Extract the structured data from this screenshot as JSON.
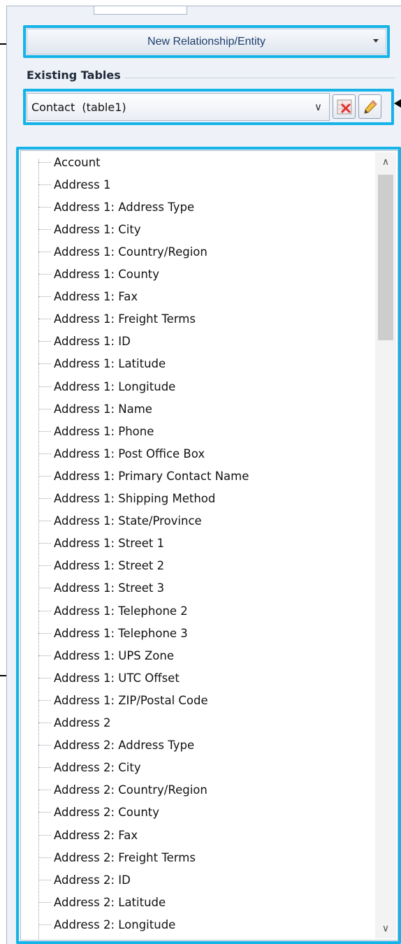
{
  "header": {
    "new_relationship_label": "New Relationship/Entity"
  },
  "existing_tables": {
    "label": "Existing Tables",
    "selected": "Contact  (table1)"
  },
  "fields": [
    "Account",
    "Address 1",
    "Address 1: Address Type",
    "Address 1: City",
    "Address 1: Country/Region",
    "Address 1: County",
    "Address 1: Fax",
    "Address 1: Freight Terms",
    "Address 1: ID",
    "Address 1: Latitude",
    "Address 1: Longitude",
    "Address 1: Name",
    "Address 1: Phone",
    "Address 1: Post Office Box",
    "Address 1: Primary Contact Name",
    "Address 1: Shipping Method",
    "Address 1: State/Province",
    "Address 1: Street 1",
    "Address 1: Street 2",
    "Address 1: Street 3",
    "Address 1: Telephone 2",
    "Address 1: Telephone 3",
    "Address 1: UPS Zone",
    "Address 1: UTC Offset",
    "Address 1: ZIP/Postal Code",
    "Address 2",
    "Address 2: Address Type",
    "Address 2: City",
    "Address 2: Country/Region",
    "Address 2: County",
    "Address 2: Fax",
    "Address 2: Freight Terms",
    "Address 2: ID",
    "Address 2: Latitude",
    "Address 2: Longitude"
  ],
  "icons": {
    "delete": "delete-table-icon",
    "edit": "edit-pencil-icon",
    "dropdown": "chevron-down-icon",
    "scroll_up": "chevron-up-icon",
    "scroll_down": "chevron-down-icon"
  },
  "colors": {
    "highlight": "#15b3e8",
    "panel_bg": "#eef2f8",
    "button_text": "#1e3f6e"
  }
}
